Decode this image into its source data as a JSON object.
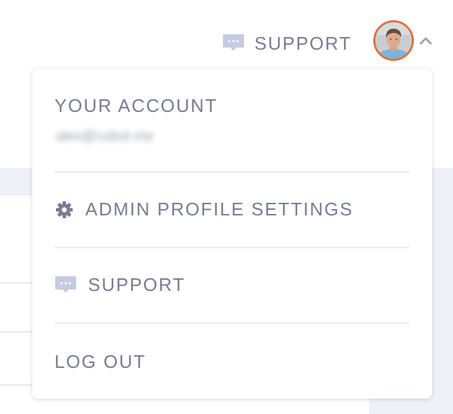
{
  "header": {
    "support_label": "SUPPORT",
    "support_icon": "chat-bubble-icon",
    "avatar_icon": "user-avatar",
    "toggle_icon": "chevron-up-icon"
  },
  "account_menu": {
    "heading": "YOUR ACCOUNT",
    "email": "alex@cobot.me",
    "items": [
      {
        "label": "ADMIN PROFILE SETTINGS",
        "icon": "gear-icon"
      },
      {
        "label": "SUPPORT",
        "icon": "chat-bubble-icon"
      },
      {
        "label": "LOG OUT",
        "icon": ""
      }
    ]
  },
  "colors": {
    "text": "#777c91",
    "icon": "#b9bfd9",
    "avatar_ring": "#e0703d",
    "divider": "#e9ebf0",
    "page_band": "#eef1f8"
  }
}
